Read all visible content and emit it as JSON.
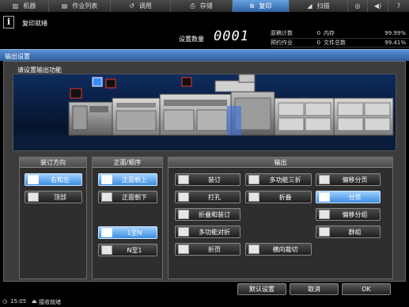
{
  "nav": {
    "tabs": [
      {
        "label": "机器",
        "icon": "machine-icon",
        "glyph": "▥"
      },
      {
        "label": "作业列表",
        "icon": "job-list-icon",
        "glyph": "▤"
      },
      {
        "label": "调用",
        "icon": "recall-icon",
        "glyph": "↺"
      },
      {
        "label": "存储",
        "icon": "store-icon",
        "glyph": "⎙"
      },
      {
        "label": "复印",
        "icon": "copy-icon",
        "glyph": "⧉"
      },
      {
        "label": "扫描",
        "icon": "scan-icon",
        "glyph": "◢"
      }
    ],
    "active_tab": "复印"
  },
  "status": {
    "message": "复印就绪",
    "copies_label": "设置数量",
    "copies_value": "0001"
  },
  "counters": [
    {
      "label": "原稿计数",
      "value": "0",
      "label2": "内存",
      "value2": "99.99%"
    },
    {
      "label": "预约作业",
      "value": "0",
      "label2": "文件总数",
      "value2": "99.41%"
    }
  ],
  "section_title": "输出设置",
  "instruction": "请设置输出功能",
  "binding": {
    "title": "装订方向",
    "options": [
      {
        "label": "右和左",
        "selected": true
      },
      {
        "label": "顶部",
        "selected": false
      }
    ]
  },
  "face": {
    "title": "正面/顺序",
    "options": [
      {
        "label": "正面朝上",
        "selected": true
      },
      {
        "label": "正面朝下",
        "selected": false
      }
    ],
    "order_options": [
      {
        "label": "1至N",
        "selected": true
      },
      {
        "label": "N至1",
        "selected": false
      }
    ]
  },
  "output": {
    "title": "输出",
    "buttons": {
      "staple": "装订",
      "multi_fold": "多功能三折",
      "offset_page": "偏移分页",
      "punch": "打孔",
      "fold": "折叠",
      "sort": "分页",
      "fold_staple": "折叠和装订",
      "offset_group": "偏移分组",
      "multi_half_fold": "多功能对折",
      "group": "群组",
      "trim_fold": "折页",
      "cross_cut": "横向裁切"
    },
    "selected": "分页"
  },
  "footer": {
    "default_label": "默认设置",
    "cancel_label": "取消",
    "ok_label": "OK"
  },
  "statusbar": {
    "time": "15:05",
    "reception": "接收就绪"
  }
}
